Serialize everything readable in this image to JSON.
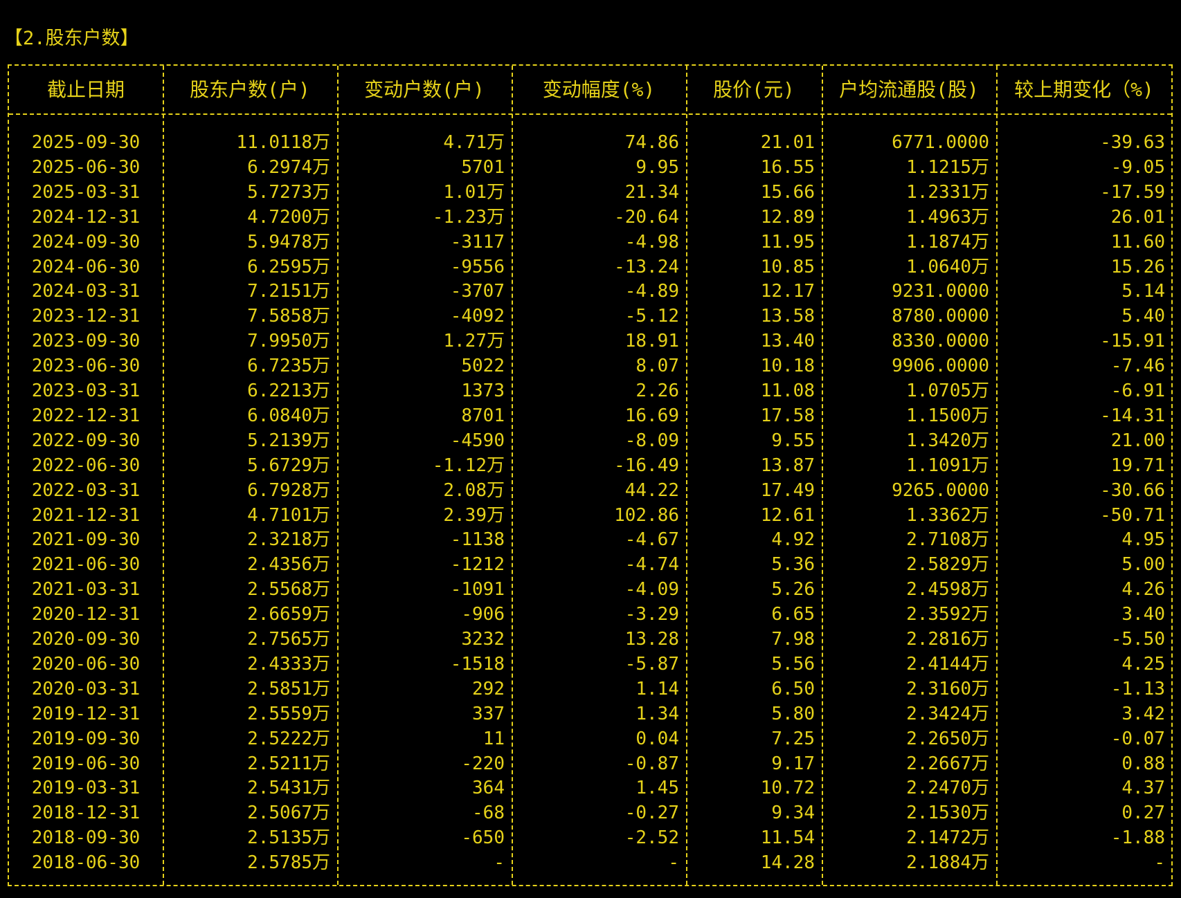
{
  "title": "【2.股东户数】",
  "headers": [
    "截止日期",
    "股东户数(户)",
    "变动户数(户)",
    "变动幅度(%)",
    "股价(元)",
    "户均流通股(股)",
    "较上期变化（%)"
  ],
  "rows": [
    [
      "2025-09-30",
      "11.0118万",
      "4.71万",
      "74.86",
      "21.01",
      "6771.0000",
      "-39.63"
    ],
    [
      "2025-06-30",
      "6.2974万",
      "5701",
      "9.95",
      "16.55",
      "1.1215万",
      "-9.05"
    ],
    [
      "2025-03-31",
      "5.7273万",
      "1.01万",
      "21.34",
      "15.66",
      "1.2331万",
      "-17.59"
    ],
    [
      "2024-12-31",
      "4.7200万",
      "-1.23万",
      "-20.64",
      "12.89",
      "1.4963万",
      "26.01"
    ],
    [
      "2024-09-30",
      "5.9478万",
      "-3117",
      "-4.98",
      "11.95",
      "1.1874万",
      "11.60"
    ],
    [
      "2024-06-30",
      "6.2595万",
      "-9556",
      "-13.24",
      "10.85",
      "1.0640万",
      "15.26"
    ],
    [
      "2024-03-31",
      "7.2151万",
      "-3707",
      "-4.89",
      "12.17",
      "9231.0000",
      "5.14"
    ],
    [
      "2023-12-31",
      "7.5858万",
      "-4092",
      "-5.12",
      "13.58",
      "8780.0000",
      "5.40"
    ],
    [
      "2023-09-30",
      "7.9950万",
      "1.27万",
      "18.91",
      "13.40",
      "8330.0000",
      "-15.91"
    ],
    [
      "2023-06-30",
      "6.7235万",
      "5022",
      "8.07",
      "10.18",
      "9906.0000",
      "-7.46"
    ],
    [
      "2023-03-31",
      "6.2213万",
      "1373",
      "2.26",
      "11.08",
      "1.0705万",
      "-6.91"
    ],
    [
      "2022-12-31",
      "6.0840万",
      "8701",
      "16.69",
      "17.58",
      "1.1500万",
      "-14.31"
    ],
    [
      "2022-09-30",
      "5.2139万",
      "-4590",
      "-8.09",
      "9.55",
      "1.3420万",
      "21.00"
    ],
    [
      "2022-06-30",
      "5.6729万",
      "-1.12万",
      "-16.49",
      "13.87",
      "1.1091万",
      "19.71"
    ],
    [
      "2022-03-31",
      "6.7928万",
      "2.08万",
      "44.22",
      "17.49",
      "9265.0000",
      "-30.66"
    ],
    [
      "2021-12-31",
      "4.7101万",
      "2.39万",
      "102.86",
      "12.61",
      "1.3362万",
      "-50.71"
    ],
    [
      "2021-09-30",
      "2.3218万",
      "-1138",
      "-4.67",
      "4.92",
      "2.7108万",
      "4.95"
    ],
    [
      "2021-06-30",
      "2.4356万",
      "-1212",
      "-4.74",
      "5.36",
      "2.5829万",
      "5.00"
    ],
    [
      "2021-03-31",
      "2.5568万",
      "-1091",
      "-4.09",
      "5.26",
      "2.4598万",
      "4.26"
    ],
    [
      "2020-12-31",
      "2.6659万",
      "-906",
      "-3.29",
      "6.65",
      "2.3592万",
      "3.40"
    ],
    [
      "2020-09-30",
      "2.7565万",
      "3232",
      "13.28",
      "7.98",
      "2.2816万",
      "-5.50"
    ],
    [
      "2020-06-30",
      "2.4333万",
      "-1518",
      "-5.87",
      "5.56",
      "2.4144万",
      "4.25"
    ],
    [
      "2020-03-31",
      "2.5851万",
      "292",
      "1.14",
      "6.50",
      "2.3160万",
      "-1.13"
    ],
    [
      "2019-12-31",
      "2.5559万",
      "337",
      "1.34",
      "5.80",
      "2.3424万",
      "3.42"
    ],
    [
      "2019-09-30",
      "2.5222万",
      "11",
      "0.04",
      "7.25",
      "2.2650万",
      "-0.07"
    ],
    [
      "2019-06-30",
      "2.5211万",
      "-220",
      "-0.87",
      "9.17",
      "2.2667万",
      "0.88"
    ],
    [
      "2019-03-31",
      "2.5431万",
      "364",
      "1.45",
      "10.72",
      "2.2470万",
      "4.37"
    ],
    [
      "2018-12-31",
      "2.5067万",
      "-68",
      "-0.27",
      "9.34",
      "2.1530万",
      "0.27"
    ],
    [
      "2018-09-30",
      "2.5135万",
      "-650",
      "-2.52",
      "11.54",
      "2.1472万",
      "-1.88"
    ],
    [
      "2018-06-30",
      "2.5785万",
      "-",
      "-",
      "14.28",
      "2.1884万",
      "-"
    ]
  ],
  "colors": {
    "background": "#000000",
    "text": "#e6d21a"
  }
}
